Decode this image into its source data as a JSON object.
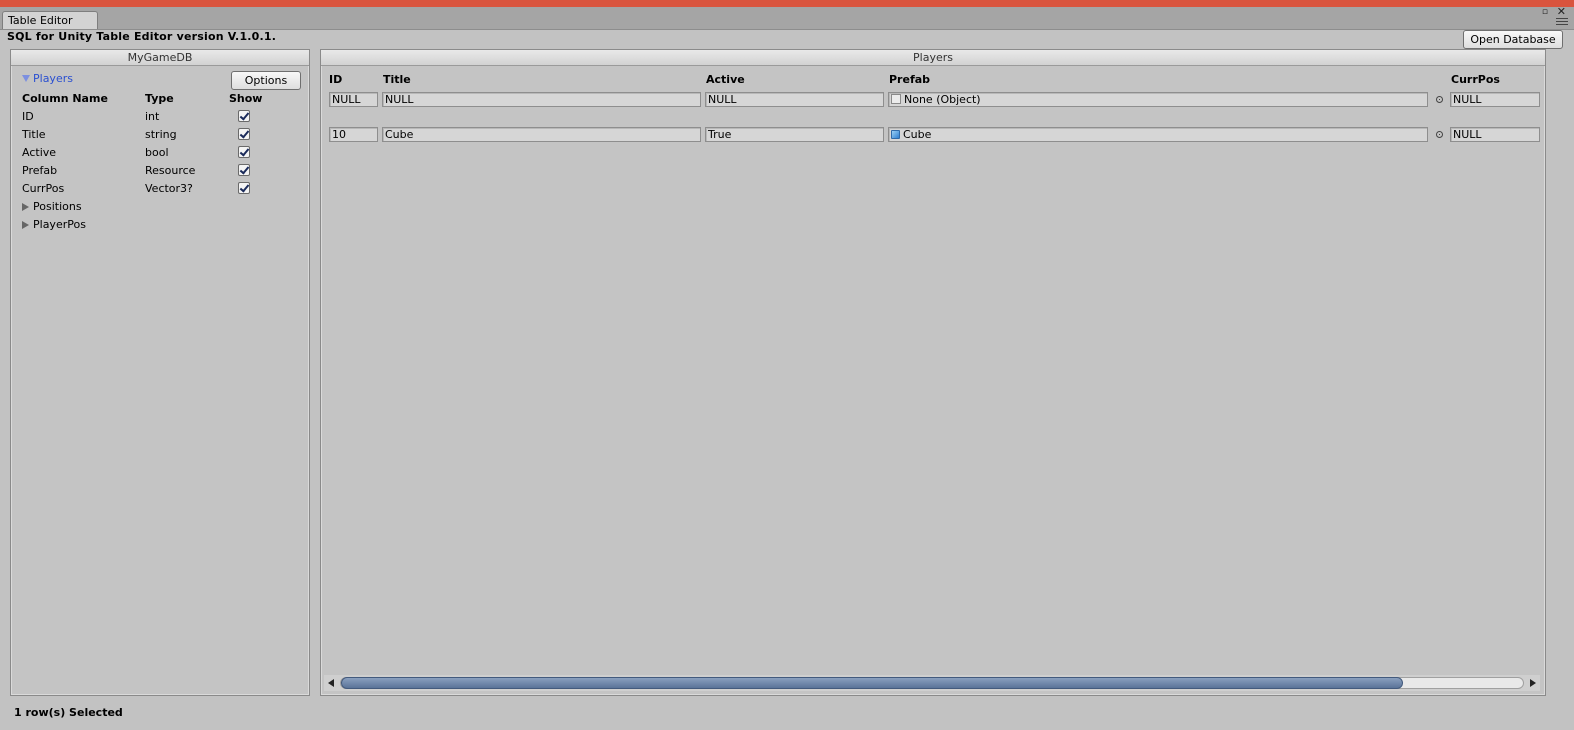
{
  "tab": {
    "label": "Table Editor"
  },
  "app": {
    "title": "SQL for Unity Table Editor version V.1.0.1."
  },
  "toolbar": {
    "open_database_label": "Open Database"
  },
  "left_panel": {
    "db_name": "MyGameDB",
    "options_label": "Options",
    "selected_table": "Players",
    "columns_header": {
      "name": "Column Name",
      "type": "Type",
      "show": "Show"
    },
    "columns": [
      {
        "name": "ID",
        "type": "int",
        "show": true
      },
      {
        "name": "Title",
        "type": "string",
        "show": true
      },
      {
        "name": "Active",
        "type": "bool",
        "show": true
      },
      {
        "name": "Prefab",
        "type": "Resource",
        "show": true
      },
      {
        "name": "CurrPos",
        "type": "Vector3?",
        "show": true
      }
    ],
    "other_tables": [
      "Positions",
      "PlayerPos"
    ]
  },
  "right_panel": {
    "title": "Players",
    "headers": {
      "id": "ID",
      "title": "Title",
      "active": "Active",
      "prefab": "Prefab",
      "currpos": "CurrPos"
    },
    "rows": [
      {
        "id": "NULL",
        "title": "NULL",
        "active": "NULL",
        "prefab": "None (Object)",
        "prefab_icon": "empty-object-icon",
        "currpos": "NULL"
      },
      {
        "id": "10",
        "title": "Cube",
        "active": "True",
        "prefab": "Cube",
        "prefab_icon": "cube-icon",
        "currpos": "NULL"
      }
    ]
  },
  "status": {
    "text": "1 row(s) Selected"
  },
  "colors": {
    "title_bar": "#d9543e",
    "panel_bg": "#c4c4c4",
    "selected_table": "#2a4fd1",
    "scroll_thumb": "#6b84a8"
  }
}
